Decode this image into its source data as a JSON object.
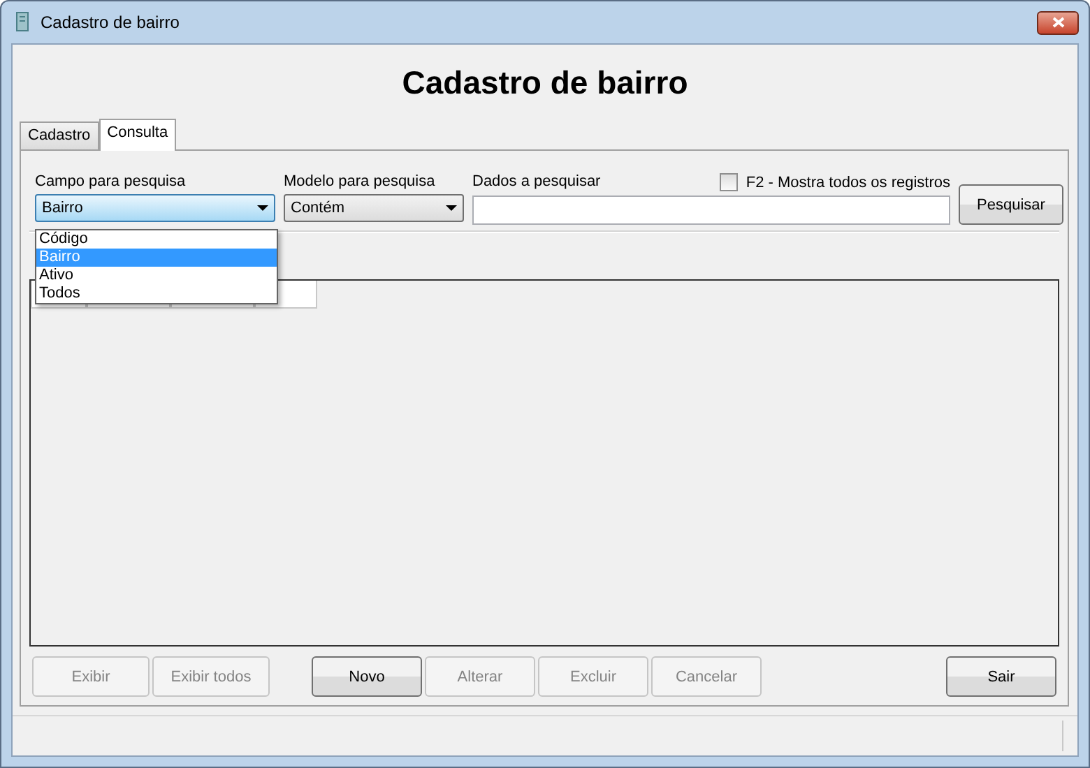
{
  "window": {
    "title": "Cadastro de bairro"
  },
  "heading": "Cadastro de bairro",
  "tabs": [
    {
      "label": "Cadastro",
      "selected": false
    },
    {
      "label": "Consulta",
      "selected": true
    }
  ],
  "search": {
    "field_label": "Campo para pesquisa",
    "field_value": "Bairro",
    "field_options": [
      {
        "label": "Código",
        "selected": false
      },
      {
        "label": "Bairro",
        "selected": true
      },
      {
        "label": "Ativo",
        "selected": false
      },
      {
        "label": "Todos",
        "selected": false
      }
    ],
    "model_label": "Modelo para pesquisa",
    "model_value": "Contém",
    "data_label": "Dados a pesquisar",
    "show_all": {
      "label": "F2 - Mostra todos os registros",
      "checked": false
    },
    "search_button": "Pesquisar"
  },
  "buttons": {
    "left": [
      {
        "label": "Exibir",
        "disabled": true
      },
      {
        "label": "Exibir todos",
        "disabled": true
      }
    ],
    "middle": [
      {
        "label": "Novo",
        "disabled": false
      },
      {
        "label": "Alterar",
        "disabled": true
      },
      {
        "label": "Excluir",
        "disabled": true
      },
      {
        "label": "Cancelar",
        "disabled": true
      }
    ],
    "right": [
      {
        "label": "Sair",
        "disabled": false
      }
    ]
  }
}
